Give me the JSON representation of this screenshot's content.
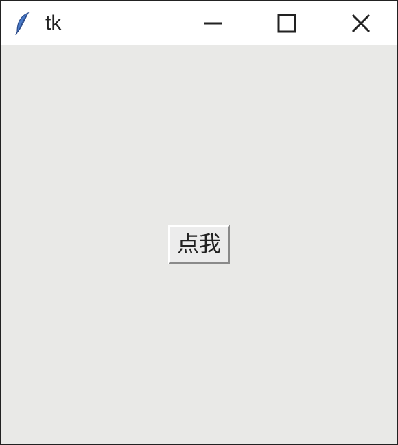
{
  "window": {
    "title": "tk",
    "icon": "feather-icon",
    "controls": {
      "minimize": "minimize-icon",
      "maximize": "maximize-icon",
      "close": "close-icon"
    }
  },
  "content": {
    "button_label": "点我"
  }
}
